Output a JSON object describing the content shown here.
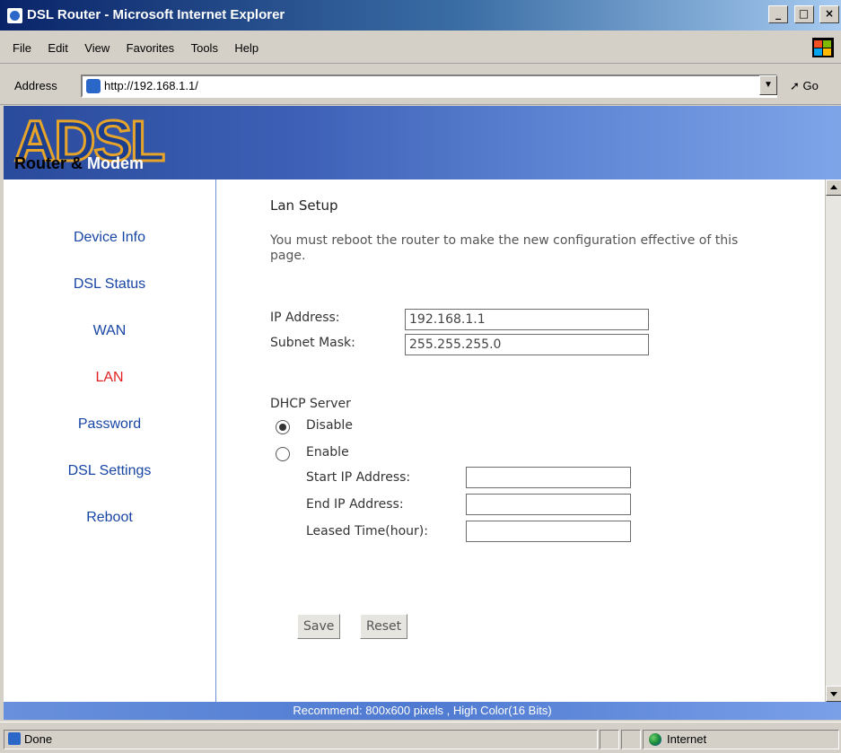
{
  "window": {
    "title": "DSL Router - Microsoft Internet Explorer",
    "controls": [
      "_",
      "□",
      "×"
    ]
  },
  "menubar": {
    "items": [
      "File",
      "Edit",
      "View",
      "Favorites",
      "Tools",
      "Help"
    ]
  },
  "addressbar": {
    "label": "Address",
    "url": "http://192.168.1.1/",
    "go": "Go"
  },
  "banner": {
    "logo_big": "ADSL",
    "logo_sub_a": "Router & ",
    "logo_sub_b": "Modem"
  },
  "sidebar": {
    "items": [
      {
        "label": "Device Info",
        "active": false
      },
      {
        "label": "DSL Status",
        "active": false
      },
      {
        "label": "WAN",
        "active": false
      },
      {
        "label": "LAN",
        "active": true
      },
      {
        "label": "Password",
        "active": false
      },
      {
        "label": "DSL Settings",
        "active": false
      },
      {
        "label": "Reboot",
        "active": false
      }
    ]
  },
  "main": {
    "heading": "Lan Setup",
    "note": "You must reboot the router to make the new configuration effective of this page.",
    "ip_label": "IP Address:",
    "ip_value": "192.168.1.1",
    "mask_label": "Subnet Mask:",
    "mask_value": "255.255.255.0",
    "dhcp_label": "DHCP Server",
    "disable_label": "Disable",
    "enable_label": "Enable",
    "dhcp_selected": "Disable",
    "start_ip_label": "Start IP Address:",
    "start_ip_value": "",
    "end_ip_label": "End IP Address:",
    "end_ip_value": "",
    "leased_label": "Leased Time(hour):",
    "leased_value": "",
    "save": "Save",
    "reset": "Reset"
  },
  "footer": {
    "text": "Recommend: 800x600 pixels , High Color(16 Bits)"
  },
  "statusbar": {
    "status": "Done",
    "zone": "Internet"
  },
  "colors": {
    "nav_link": "#1846a5",
    "nav_active": "#e02222",
    "banner": "#3d60b6"
  }
}
